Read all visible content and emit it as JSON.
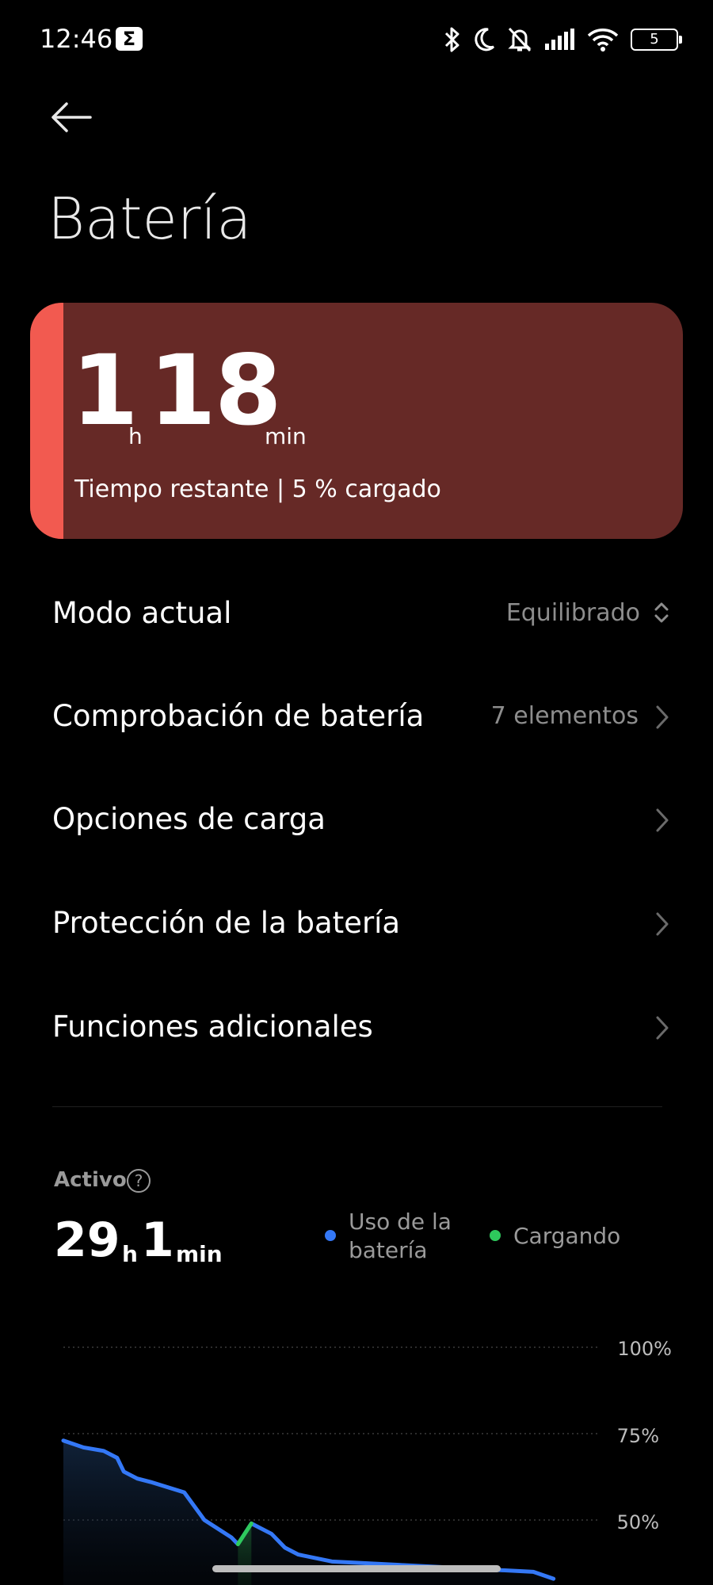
{
  "status_bar": {
    "time": "12:46",
    "notification_badge": "Σ",
    "battery_level": "5",
    "icons": [
      "bluetooth-icon",
      "moon-icon",
      "bell-off-icon",
      "signal-icon",
      "wifi-icon",
      "battery-icon"
    ]
  },
  "header": {
    "title": "Batería",
    "back_icon": "arrow-left-icon"
  },
  "battery_card": {
    "hours": "1",
    "hours_unit": "h",
    "minutes": "18",
    "minutes_unit": "min",
    "subtitle": "Tiempo restante | 5 % cargado",
    "colors": {
      "background": "#662926",
      "accent": "#f25a50"
    }
  },
  "menu": {
    "items": [
      {
        "label": "Modo actual",
        "value": "Equilibrado",
        "icon": "chevron-updown-icon"
      },
      {
        "label": "Comprobación de batería",
        "value": "7 elementos",
        "icon": "chevron-right-icon"
      },
      {
        "label": "Opciones de carga",
        "value": "",
        "icon": "chevron-right-icon"
      },
      {
        "label": "Protección de la batería",
        "value": "",
        "icon": "chevron-right-icon"
      },
      {
        "label": "Funciones adicionales",
        "value": "",
        "icon": "chevron-right-icon"
      }
    ]
  },
  "usage": {
    "active_label": "Activo",
    "help_icon": "?",
    "hours": "29",
    "hours_unit": "h",
    "minutes": "1",
    "minutes_unit": "min",
    "legend": [
      {
        "label": "Uso de la",
        "label_line2": "batería",
        "color": "#3478f6"
      },
      {
        "label": "Cargando",
        "color": "#2ec95c"
      }
    ]
  },
  "chart_data": {
    "type": "line",
    "y_ticks": [
      "100%",
      "75%",
      "50%"
    ],
    "ylim": [
      0,
      100
    ],
    "series": [
      {
        "name": "Uso de la batería",
        "color": "#3478f6",
        "x": [
          0,
          3,
          6,
          8,
          9,
          11,
          13,
          18,
          21,
          25,
          26,
          28,
          31,
          33,
          35,
          40,
          50,
          60,
          70,
          73
        ],
        "values": [
          73,
          71,
          70,
          68,
          64,
          62,
          61,
          58,
          50,
          45,
          43,
          49,
          46,
          42,
          40,
          38,
          37,
          36,
          35,
          33
        ]
      },
      {
        "name": "Cargando",
        "color": "#2ec95c",
        "x": [
          26,
          28
        ],
        "values": [
          43,
          49
        ]
      }
    ]
  }
}
